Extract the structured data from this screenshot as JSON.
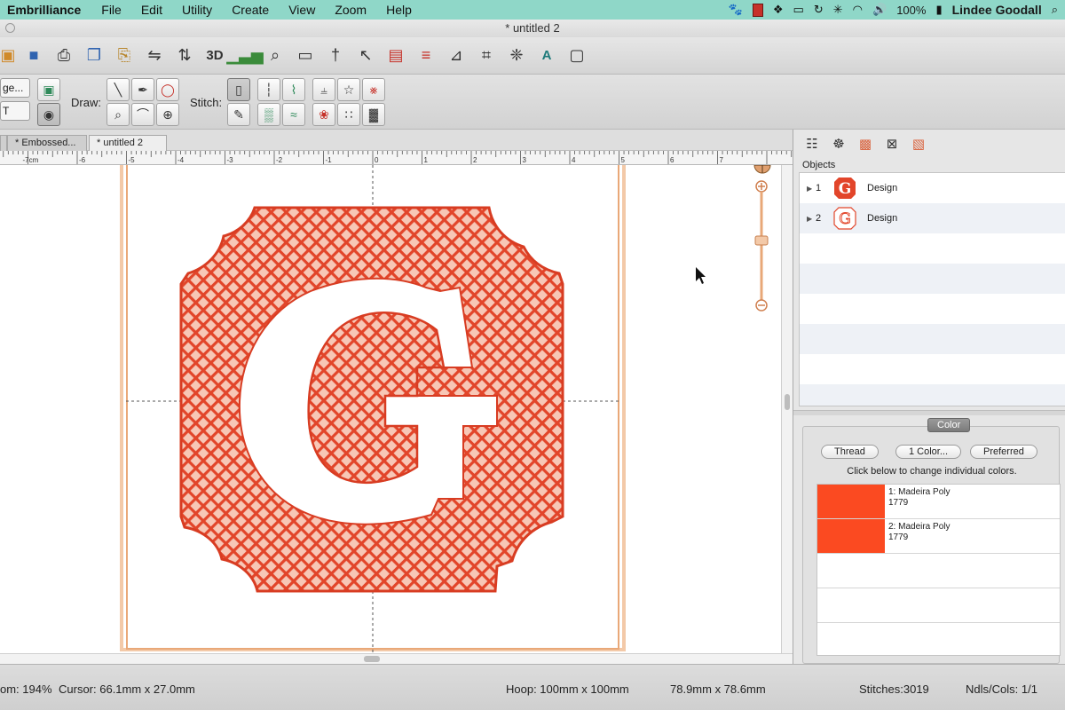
{
  "menubar": {
    "app": "Embrilliance",
    "items": [
      "File",
      "Edit",
      "Utility",
      "Create",
      "View",
      "Zoom",
      "Help"
    ],
    "battery": "100%",
    "user": "Lindee Goodall"
  },
  "window": {
    "title": "* untitled 2"
  },
  "toolbar": {
    "view_3d_label": "3D",
    "text_tool_label": "A"
  },
  "toolbar2": {
    "left_top_label": "ge...",
    "left_bottom_label": "T",
    "draw_label": "Draw:",
    "stitch_label": "Stitch:"
  },
  "tabs": [
    {
      "label": "* Embossed..."
    },
    {
      "label": "* untitled 2"
    }
  ],
  "ruler": {
    "labels": [
      "7cm",
      "6",
      "5",
      "4",
      "3",
      "2",
      "1",
      "0",
      "1",
      "2",
      "3",
      "4",
      "5",
      "6",
      "7"
    ]
  },
  "objects": {
    "title": "Objects",
    "rows": [
      {
        "num": "1",
        "name": "Design"
      },
      {
        "num": "2",
        "name": "Design"
      }
    ]
  },
  "color_panel": {
    "tab_label": "Color",
    "thread_btn": "Thread",
    "color_count_btn": "1 Color...",
    "preferred_btn": "Preferred",
    "hint": "Click below to change individual colors.",
    "threads": [
      {
        "line1": "1: Madeira Poly",
        "line2": "1779",
        "color": "#fb4a21"
      },
      {
        "line1": "2: Madeira Poly",
        "line2": "1779",
        "color": "#fb4a21"
      }
    ]
  },
  "zoom_compass": "N",
  "design_letter": "G",
  "status": {
    "zoom": "om: 194%",
    "cursor": "Cursor: 66.1mm x 27.0mm",
    "hoop": "Hoop: 100mm x 100mm",
    "size": "78.9mm x 78.6mm",
    "stitches": "Stitches:3019",
    "needles": "Ndls/Cols: 1/1"
  },
  "colors": {
    "menubar": "#8fd7c8",
    "stitch_red": "#e2452a",
    "hoop_orange": "#e9a878"
  }
}
